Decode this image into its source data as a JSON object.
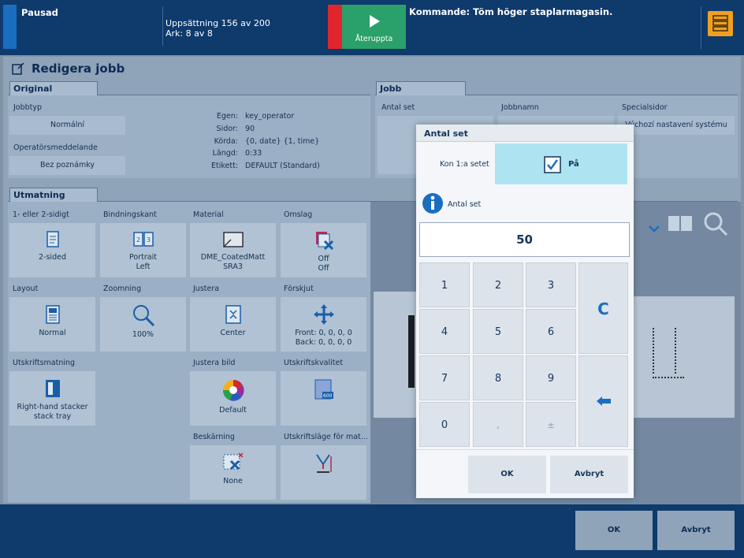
{
  "top": {
    "status": "Pausad",
    "progress_line1": "Uppsättning 156 av 200",
    "progress_line2": "Ark: 8 av 8",
    "resume_label": "Återuppta",
    "command": "Kommande: Töm höger staplarmagasin."
  },
  "panel": {
    "title": "Redigera jobb"
  },
  "original": {
    "tab": "Original",
    "jobtype_label": "Jobbtyp",
    "jobtype_value": "Normální",
    "opmsg_label": "Operatörsmeddelande",
    "opmsg_value": "Bez poznámky",
    "info": [
      {
        "k": "Egen:",
        "v": "key_operator"
      },
      {
        "k": "Sidor:",
        "v": "90"
      },
      {
        "k": "Körda:",
        "v": "{0, date} {1, time}"
      },
      {
        "k": "Längd:",
        "v": "0:33"
      },
      {
        "k": "Etikett:",
        "v": "DEFAULT (Standard)"
      }
    ]
  },
  "job": {
    "tab": "Jobb",
    "copies_label": "Antal set",
    "name_label": "Jobbnamn",
    "special_label": "Specialsidor",
    "special_value": "Výchozí nastavení systému"
  },
  "output": {
    "tab": "Utmatning",
    "tiles": [
      {
        "label": "1- eller 2-sidigt",
        "value": "2-sided",
        "value2": ""
      },
      {
        "label": "Bindningskant",
        "value": "Portrait",
        "value2": "Left"
      },
      {
        "label": "Material",
        "value": "DME_CoatedMatt",
        "value2": "SRA3"
      },
      {
        "label": "Omslag",
        "value": "Off",
        "value2": "Off"
      },
      {
        "label": "Layout",
        "value": "Normal",
        "value2": ""
      },
      {
        "label": "Zoomning",
        "value": "100%",
        "value2": ""
      },
      {
        "label": "Justera",
        "value": "Center",
        "value2": ""
      },
      {
        "label": "Förskjut",
        "value": "Front: 0, 0, 0, 0",
        "value2": "Back: 0, 0, 0, 0"
      },
      {
        "label": "Utskriftsmatning",
        "value": "Right-hand stacker",
        "value2": "stack tray"
      },
      {
        "label": "Justera bild",
        "value": "Default",
        "value2": ""
      },
      {
        "label": "Utskriftskvalitet",
        "value": "",
        "value2": ""
      },
      {
        "label": "Beskärning",
        "value": "None",
        "value2": ""
      },
      {
        "label": "Utskriftsläge för mat...",
        "value": "",
        "value2": ""
      }
    ]
  },
  "dialog": {
    "title": "Antal set",
    "collate_label": "Kon 1:a setet",
    "collate_value": "På",
    "info_label": "Antal set",
    "value": "50",
    "keys": [
      "1",
      "2",
      "3",
      "4",
      "5",
      "6",
      "7",
      "8",
      "9",
      "0",
      ",",
      "±"
    ],
    "clear": "C",
    "ok": "OK",
    "cancel": "Avbryt"
  },
  "footer": {
    "ok": "OK",
    "cancel": "Avbryt"
  },
  "colors": {
    "navy": "#0e3a6c",
    "green": "#2aa06a",
    "red": "#e0262c",
    "orange": "#f0a020",
    "accent": "#1a6ec0",
    "on": "#aee4f2"
  }
}
